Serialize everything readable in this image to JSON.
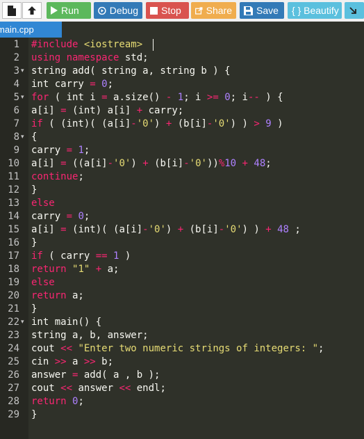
{
  "toolbar": {
    "new_file_icon": "file-icon",
    "upload_icon": "upload-icon",
    "run_label": "Run",
    "debug_label": "Debug",
    "stop_label": "Stop",
    "share_label": "Share",
    "save_label": "Save",
    "beautify_label": "{ } Beautify",
    "language_icon": "download-arrow-icon",
    "colors": {
      "run": "#5cb85c",
      "debug": "#337ab7",
      "stop": "#d9534f",
      "share": "#f0ad4e",
      "save": "#337ab7",
      "beautify": "#5bc0de"
    }
  },
  "tab": {
    "filename": "main.cpp",
    "color": "#3187d4"
  },
  "editor": {
    "theme_bg": "#2f3129",
    "folds": [
      3,
      5,
      8,
      22
    ],
    "lines": [
      [
        [
          "kw",
          "#include "
        ],
        [
          "str",
          "<iostream>"
        ]
      ],
      [
        [
          "kw",
          "using namespace "
        ],
        [
          "id",
          "std;"
        ]
      ],
      [
        [
          "id",
          "string add( string a, string b ) {"
        ]
      ],
      [
        [
          "id",
          "int carry "
        ],
        [
          "op",
          "="
        ],
        [
          "id",
          " "
        ],
        [
          "num",
          "0"
        ],
        [
          "id",
          ";"
        ]
      ],
      [
        [
          "kw",
          "for"
        ],
        [
          "id",
          " ( int i "
        ],
        [
          "op",
          "="
        ],
        [
          "id",
          " a.size() "
        ],
        [
          "op",
          "-"
        ],
        [
          "id",
          " "
        ],
        [
          "num",
          "1"
        ],
        [
          "id",
          "; i "
        ],
        [
          "op",
          ">="
        ],
        [
          "id",
          " "
        ],
        [
          "num",
          "0"
        ],
        [
          "id",
          "; i"
        ],
        [
          "op",
          "--"
        ],
        [
          "id",
          " ) {"
        ]
      ],
      [
        [
          "id",
          "a[i] "
        ],
        [
          "op",
          "="
        ],
        [
          "id",
          " (int) a[i] "
        ],
        [
          "op",
          "+"
        ],
        [
          "id",
          " carry;"
        ]
      ],
      [
        [
          "kw",
          "if"
        ],
        [
          "id",
          " ( (int)( (a[i]"
        ],
        [
          "op",
          "-"
        ],
        [
          "str",
          "'0'"
        ],
        [
          "id",
          ") "
        ],
        [
          "op",
          "+"
        ],
        [
          "id",
          " (b[i]"
        ],
        [
          "op",
          "-"
        ],
        [
          "str",
          "'0'"
        ],
        [
          "id",
          ") ) "
        ],
        [
          "op",
          ">"
        ],
        [
          "id",
          " "
        ],
        [
          "num",
          "9"
        ],
        [
          "id",
          " )"
        ]
      ],
      [
        [
          "id",
          "{"
        ]
      ],
      [
        [
          "id",
          "carry "
        ],
        [
          "op",
          "="
        ],
        [
          "id",
          " "
        ],
        [
          "num",
          "1"
        ],
        [
          "id",
          ";"
        ]
      ],
      [
        [
          "id",
          "a[i] "
        ],
        [
          "op",
          "="
        ],
        [
          "id",
          " ((a[i]"
        ],
        [
          "op",
          "-"
        ],
        [
          "str",
          "'0'"
        ],
        [
          "id",
          ") "
        ],
        [
          "op",
          "+"
        ],
        [
          "id",
          " (b[i]"
        ],
        [
          "op",
          "-"
        ],
        [
          "str",
          "'0'"
        ],
        [
          "id",
          "))"
        ],
        [
          "op",
          "%"
        ],
        [
          "num",
          "10"
        ],
        [
          "id",
          " "
        ],
        [
          "op",
          "+"
        ],
        [
          "id",
          " "
        ],
        [
          "num",
          "48"
        ],
        [
          "id",
          ";"
        ]
      ],
      [
        [
          "kw",
          "continue"
        ],
        [
          "id",
          ";"
        ]
      ],
      [
        [
          "id",
          "}"
        ]
      ],
      [
        [
          "kw",
          "else"
        ]
      ],
      [
        [
          "id",
          "carry "
        ],
        [
          "op",
          "="
        ],
        [
          "id",
          " "
        ],
        [
          "num",
          "0"
        ],
        [
          "id",
          ";"
        ]
      ],
      [
        [
          "id",
          "a[i] "
        ],
        [
          "op",
          "="
        ],
        [
          "id",
          " (int)( (a[i]"
        ],
        [
          "op",
          "-"
        ],
        [
          "str",
          "'0'"
        ],
        [
          "id",
          ") "
        ],
        [
          "op",
          "+"
        ],
        [
          "id",
          " (b[i]"
        ],
        [
          "op",
          "-"
        ],
        [
          "str",
          "'0'"
        ],
        [
          "id",
          ") ) "
        ],
        [
          "op",
          "+"
        ],
        [
          "id",
          " "
        ],
        [
          "num",
          "48"
        ],
        [
          "id",
          " ;"
        ]
      ],
      [
        [
          "id",
          "}"
        ]
      ],
      [
        [
          "kw",
          "if"
        ],
        [
          "id",
          " ( carry "
        ],
        [
          "op",
          "=="
        ],
        [
          "id",
          " "
        ],
        [
          "num",
          "1"
        ],
        [
          "id",
          " )"
        ]
      ],
      [
        [
          "kw",
          "return"
        ],
        [
          "id",
          " "
        ],
        [
          "str",
          "\"1\""
        ],
        [
          "id",
          " "
        ],
        [
          "op",
          "+"
        ],
        [
          "id",
          " a;"
        ]
      ],
      [
        [
          "kw",
          "else"
        ]
      ],
      [
        [
          "kw",
          "return"
        ],
        [
          "id",
          " a;"
        ]
      ],
      [
        [
          "id",
          "}"
        ]
      ],
      [
        [
          "id",
          "int main() {"
        ]
      ],
      [
        [
          "id",
          "string a, b, answer;"
        ]
      ],
      [
        [
          "id",
          "cout "
        ],
        [
          "op",
          "<<"
        ],
        [
          "id",
          " "
        ],
        [
          "str",
          "\"Enter two numeric strings of integers: \""
        ],
        [
          "id",
          ";"
        ]
      ],
      [
        [
          "id",
          "cin "
        ],
        [
          "op",
          ">>"
        ],
        [
          "id",
          " a "
        ],
        [
          "op",
          ">>"
        ],
        [
          "id",
          " b;"
        ]
      ],
      [
        [
          "id",
          "answer "
        ],
        [
          "op",
          "="
        ],
        [
          "id",
          " add( a , b );"
        ]
      ],
      [
        [
          "id",
          "cout "
        ],
        [
          "op",
          "<<"
        ],
        [
          "id",
          " answer "
        ],
        [
          "op",
          "<<"
        ],
        [
          "id",
          " endl;"
        ]
      ],
      [
        [
          "kw",
          "return"
        ],
        [
          "id",
          " "
        ],
        [
          "num",
          "0"
        ],
        [
          "id",
          ";"
        ]
      ],
      [
        [
          "id",
          "}"
        ]
      ]
    ]
  }
}
